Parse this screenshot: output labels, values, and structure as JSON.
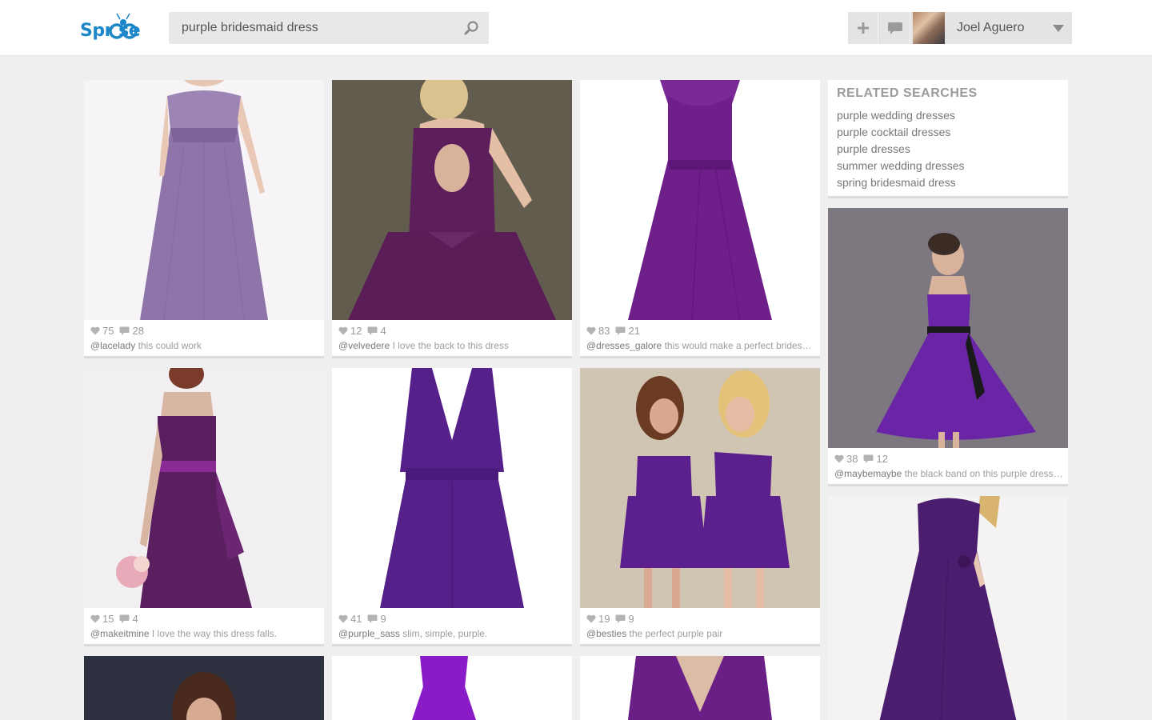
{
  "header": {
    "logo_text": "Spr  se",
    "search_value": "purple bridesmaid dress",
    "user_name": "Joel Aguero"
  },
  "related": {
    "title": "RELATED SEARCHES",
    "items": [
      "purple wedding dresses",
      "purple cocktail dresses",
      "purple dresses",
      "summer wedding dresses",
      "spring bridesmaid dress"
    ]
  },
  "cards": [
    {
      "likes": "75",
      "comments": "28",
      "user": "@lacelady",
      "caption": "this could work",
      "dress_color": "#8e74a8",
      "bg": "#f6f4f6"
    },
    {
      "likes": "12",
      "comments": "4",
      "user": "@velvedere",
      "caption": "I love the back to this dress",
      "dress_color": "#5d1f5b",
      "bg": "#5a5447"
    },
    {
      "likes": "83",
      "comments": "21",
      "user": "@dresses_galore",
      "caption": "this would make a perfect bridesmaid dress",
      "dress_color": "#6f1f8a",
      "bg": "#ffffff"
    },
    {
      "likes": "38",
      "comments": "12",
      "user": "@maybemaybe",
      "caption": "the black band on this purple dress is perfect",
      "dress_color": "#6a25a7",
      "bg": "#7d7880"
    },
    {
      "likes": "15",
      "comments": "4",
      "user": "@makeitmine",
      "caption": "I love the way this dress falls.",
      "dress_color": "#5a1f5f",
      "bg": "#f1eff1"
    },
    {
      "likes": "41",
      "comments": "9",
      "user": "@purple_sass",
      "caption": "slim, simple, purple.",
      "dress_color": "#55208a",
      "bg": "#ffffff"
    },
    {
      "likes": "19",
      "comments": "9",
      "user": "@besties",
      "caption": "the perfect purple pair",
      "dress_color": "#5b1f8e",
      "bg": "#c9bca9"
    }
  ]
}
